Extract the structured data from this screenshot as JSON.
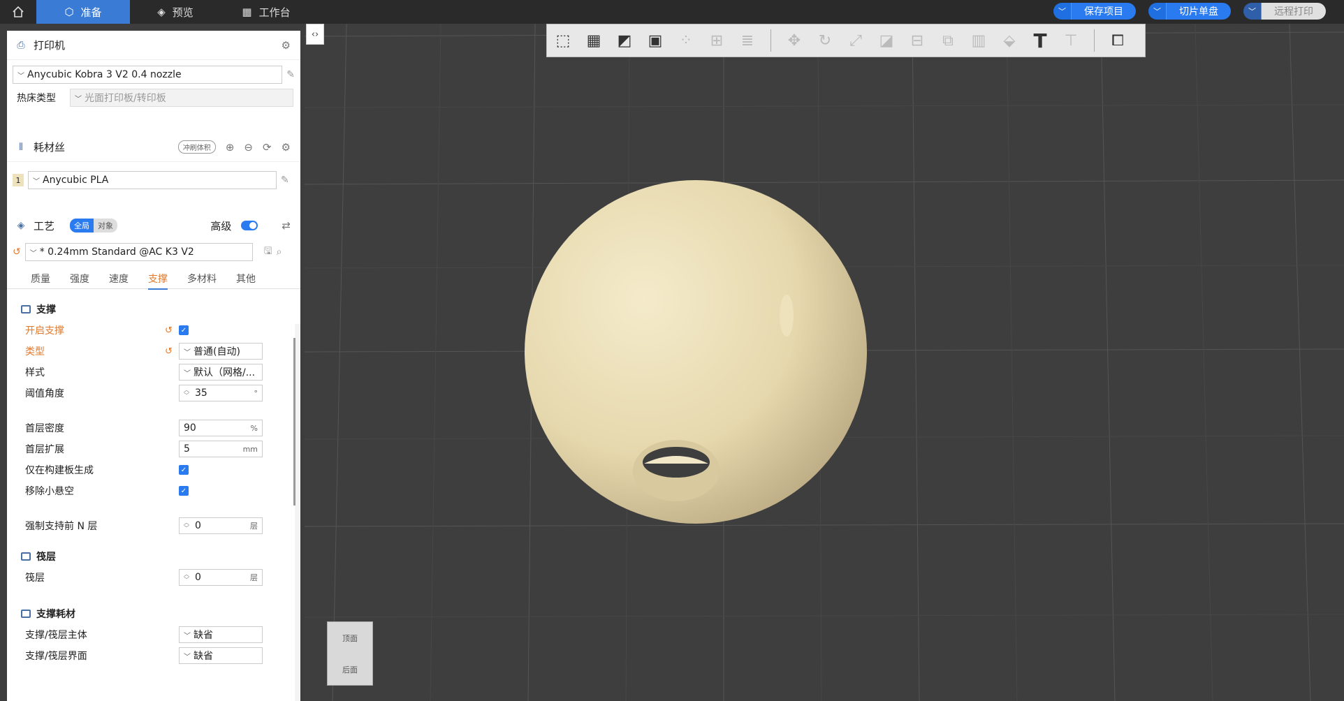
{
  "topbar": {
    "tabs": [
      {
        "label": "准备",
        "icon": "cube-icon"
      },
      {
        "label": "预览",
        "icon": "layers-icon"
      },
      {
        "label": "工作台",
        "icon": "grid-icon"
      }
    ],
    "actions": [
      {
        "label": "保存项目"
      },
      {
        "label": "切片单盘"
      },
      {
        "label": "远程打印"
      }
    ]
  },
  "printer": {
    "title": "打印机",
    "model": "Anycubic Kobra 3 V2 0.4 nozzle",
    "bed_label": "热床类型",
    "bed_value": "光面打印板/转印板"
  },
  "filament": {
    "title": "耗材丝",
    "flush_label": "冲刷体积",
    "slot": "1",
    "name": "Anycubic PLA"
  },
  "process": {
    "title": "工艺",
    "global": "全局",
    "object": "对象",
    "advanced": "高级",
    "preset": "* 0.24mm Standard @AC K3 V2",
    "tabs": [
      "质量",
      "强度",
      "速度",
      "支撑",
      "多材料",
      "其他"
    ]
  },
  "support": {
    "group1": "支撑",
    "enable": "开启支撑",
    "type_label": "类型",
    "type_value": "普通(自动)",
    "style_label": "样式",
    "style_value": "默认（网格/...",
    "threshold_label": "阈值角度",
    "threshold_value": "35",
    "threshold_unit": "°",
    "first_density_label": "首层密度",
    "first_density_value": "90",
    "first_density_unit": "%",
    "first_expand_label": "首层扩展",
    "first_expand_value": "5",
    "first_expand_unit": "mm",
    "on_plate_label": "仅在构建板生成",
    "remove_small_label": "移除小悬空",
    "enforce_label": "强制支持前 N 层",
    "enforce_value": "0",
    "layer_unit": "层",
    "group2": "筏层",
    "raft_label": "筏层",
    "raft_value": "0",
    "group3": "支撑耗材",
    "base_label": "支撑/筏层主体",
    "base_value": "缺省",
    "iface_label": "支撑/筏层界面",
    "iface_value": "缺省"
  },
  "cube": {
    "top": "顶面",
    "front": "后面"
  },
  "colors": {
    "accent": "#2a7bf0",
    "orange": "#e07a2e",
    "model": "#eee2bc"
  }
}
